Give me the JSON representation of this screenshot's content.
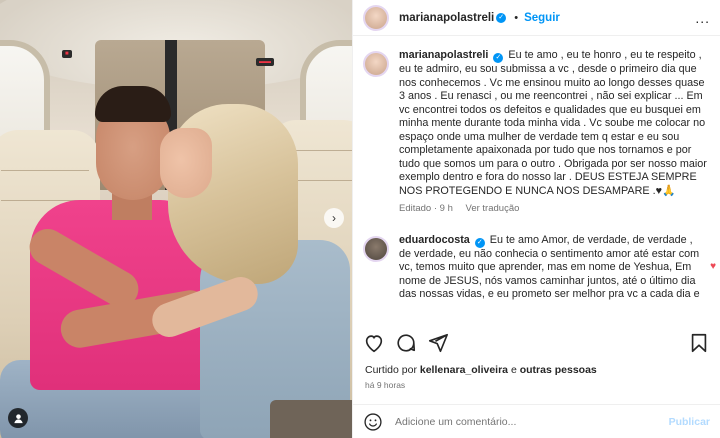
{
  "post": {
    "author": "marianapolastreli",
    "follow_label": "Seguir",
    "separator": "•",
    "more_label": "..."
  },
  "caption": {
    "username": "marianapolastreli",
    "text": "Eu te amo , eu te honro , eu te respeito , eu te admiro, eu sou submissa a vc , desde o primeiro dia que nos conhecemos . Vc me ensinou muito ao longo desses quase 3 anos . Eu renasci , ou me reencontrei , não sei explicar ... Em vc encontrei todos os defeitos e qualidades que eu busquei em minha mente durante toda minha vida . Vc soube me colocar no espaço onde uma mulher de verdade tem q estar e eu sou completamente apaixonada por tudo que nos tornamos e por tudo que somos um para o outro . Obrigada por ser nosso maior exemplo dentro e fora do nosso lar . DEUS ESTEJA SEMPRE NOS PROTEGENDO E NUNCA NOS DESAMPARE .♥🙏",
    "edited": "Editado · 9 h",
    "translate": "Ver tradução"
  },
  "reply": {
    "username": "eduardocosta",
    "text": "Eu te amo Amor, de verdade, de verdade , de verdade, eu não conhecia o sentimento amor até estar com vc, temos muito que aprender, mas em nome de Yeshua, Em nome de JESUS, nós vamos caminhar juntos, até o último dia das nossas vidas, e eu prometo ser melhor pra vc a cada dia e"
  },
  "likes": {
    "prefix": "Curtido por",
    "user": "kellenara_oliveira",
    "middle": "e",
    "others": "outras pessoas"
  },
  "timestamp": "há 9 horas",
  "comment_box": {
    "placeholder": "Adicione um comentário...",
    "post_label": "Publicar"
  },
  "colors": {
    "accent": "#0095f6",
    "like_red": "#ed4956",
    "shirt_pink": "#f0428c"
  },
  "icons": [
    "heart-icon",
    "comment-icon",
    "share-icon",
    "bookmark-icon",
    "emoji-icon",
    "more-icon",
    "verified-icon",
    "tag-user-icon",
    "chevron-right-icon"
  ]
}
